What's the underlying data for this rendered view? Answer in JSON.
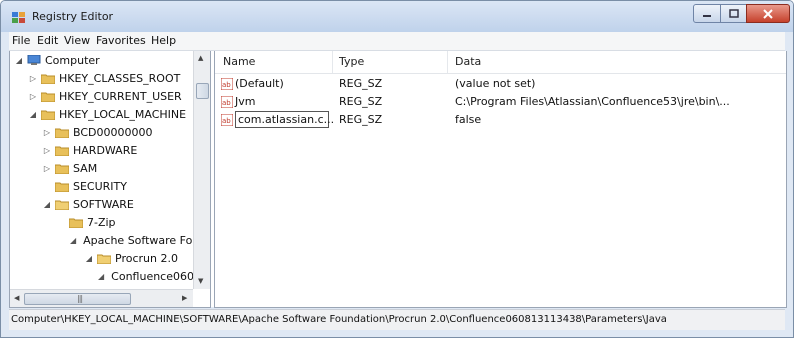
{
  "window": {
    "title": "Registry Editor"
  },
  "menu": [
    "File",
    "Edit",
    "View",
    "Favorites",
    "Help"
  ],
  "tree": {
    "nodes": [
      {
        "label": "Computer",
        "expander": "◢"
      },
      {
        "label": "HKEY_CLASSES_ROOT",
        "expander": "▷"
      },
      {
        "label": "HKEY_CURRENT_USER",
        "expander": "▷"
      },
      {
        "label": "HKEY_LOCAL_MACHINE",
        "expander": "◢"
      },
      {
        "label": "BCD00000000",
        "expander": "▷"
      },
      {
        "label": "HARDWARE",
        "expander": "▷"
      },
      {
        "label": "SAM",
        "expander": "▷"
      },
      {
        "label": "SECURITY",
        "expander": ""
      },
      {
        "label": "SOFTWARE",
        "expander": "◢"
      },
      {
        "label": "7-Zip",
        "expander": ""
      },
      {
        "label": "Apache Software Foundation",
        "expander": "◢"
      },
      {
        "label": "Procrun 2.0",
        "expander": "◢"
      },
      {
        "label": "Confluence060813113438",
        "expander": "◢"
      }
    ]
  },
  "list": {
    "columns": [
      "Name",
      "Type",
      "Data"
    ],
    "rows": [
      {
        "name": "(Default)",
        "type": "REG_SZ",
        "data": "(value not set)"
      },
      {
        "name": "Jvm",
        "type": "REG_SZ",
        "data": "C:\\Program Files\\Atlassian\\Confluence53\\jre\\bin\\..."
      },
      {
        "name": "com.atlassian.c...",
        "type": "REG_SZ",
        "data": "false"
      }
    ]
  },
  "status": {
    "path": "Computer\\HKEY_LOCAL_MACHINE\\SOFTWARE\\Apache Software Foundation\\Procrun 2.0\\Confluence060813113438\\Parameters\\Java"
  },
  "icons": {
    "app": "registry-editor-icon",
    "folder": "folder-icon",
    "computer": "computer-icon",
    "string_value": "reg-sz-icon"
  },
  "colors": {
    "title_bar": "#bfd2eb",
    "close_button": "#c6412c",
    "folder": "#e8c05a"
  }
}
